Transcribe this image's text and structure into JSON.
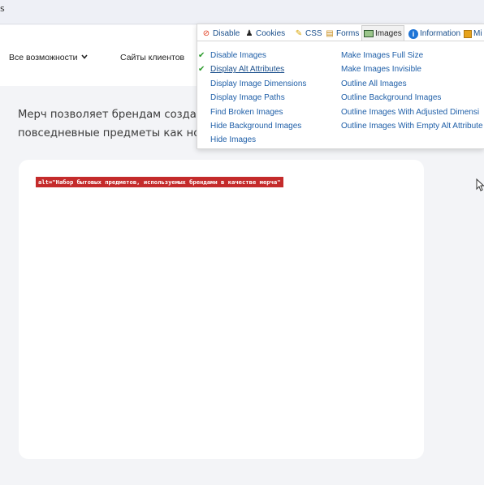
{
  "browser": {
    "tab_fragment": "s"
  },
  "nav": {
    "features": "Все возможности",
    "clients": "Сайты клиентов"
  },
  "body_text": {
    "line1": "Мерч позволяет брендам создавать",
    "line2": "повседневные предметы как носите"
  },
  "image_alt": "alt=\"Набор бытовых предметов, используемых брендами в качестве мерча\"",
  "webdev": {
    "tabs": [
      {
        "label": "Disable",
        "icon": "disable-icon"
      },
      {
        "label": "Cookies",
        "icon": "cookies-icon"
      },
      {
        "label": "CSS",
        "icon": "css-icon"
      },
      {
        "label": "Forms",
        "icon": "forms-icon"
      },
      {
        "label": "Images",
        "icon": "images-icon",
        "active": true
      },
      {
        "label": "Information",
        "icon": "information-icon"
      },
      {
        "label": "Mi",
        "icon": "miscellaneous-icon"
      }
    ],
    "left_items": [
      {
        "label": "Disable Images",
        "checked": true
      },
      {
        "label": "Display Alt Attributes",
        "checked": true
      },
      {
        "label": "Display Image Dimensions",
        "checked": false
      },
      {
        "label": "Display Image Paths",
        "checked": false
      },
      {
        "label": "Find Broken Images",
        "checked": false
      },
      {
        "label": "Hide Background Images",
        "checked": false
      },
      {
        "label": "Hide Images",
        "checked": false
      }
    ],
    "right_items": [
      {
        "label": "Make Images Full Size"
      },
      {
        "label": "Make Images Invisible"
      },
      {
        "label": "Outline All Images"
      },
      {
        "label": "Outline Background Images"
      },
      {
        "label": "Outline Images With Adjusted Dimensi"
      },
      {
        "label": "Outline Images With Empty Alt Attribute"
      }
    ],
    "colors": {
      "link": "#1f5fa8",
      "check": "#2a9a2a",
      "alt_label_bg": "#c42b2b"
    }
  }
}
